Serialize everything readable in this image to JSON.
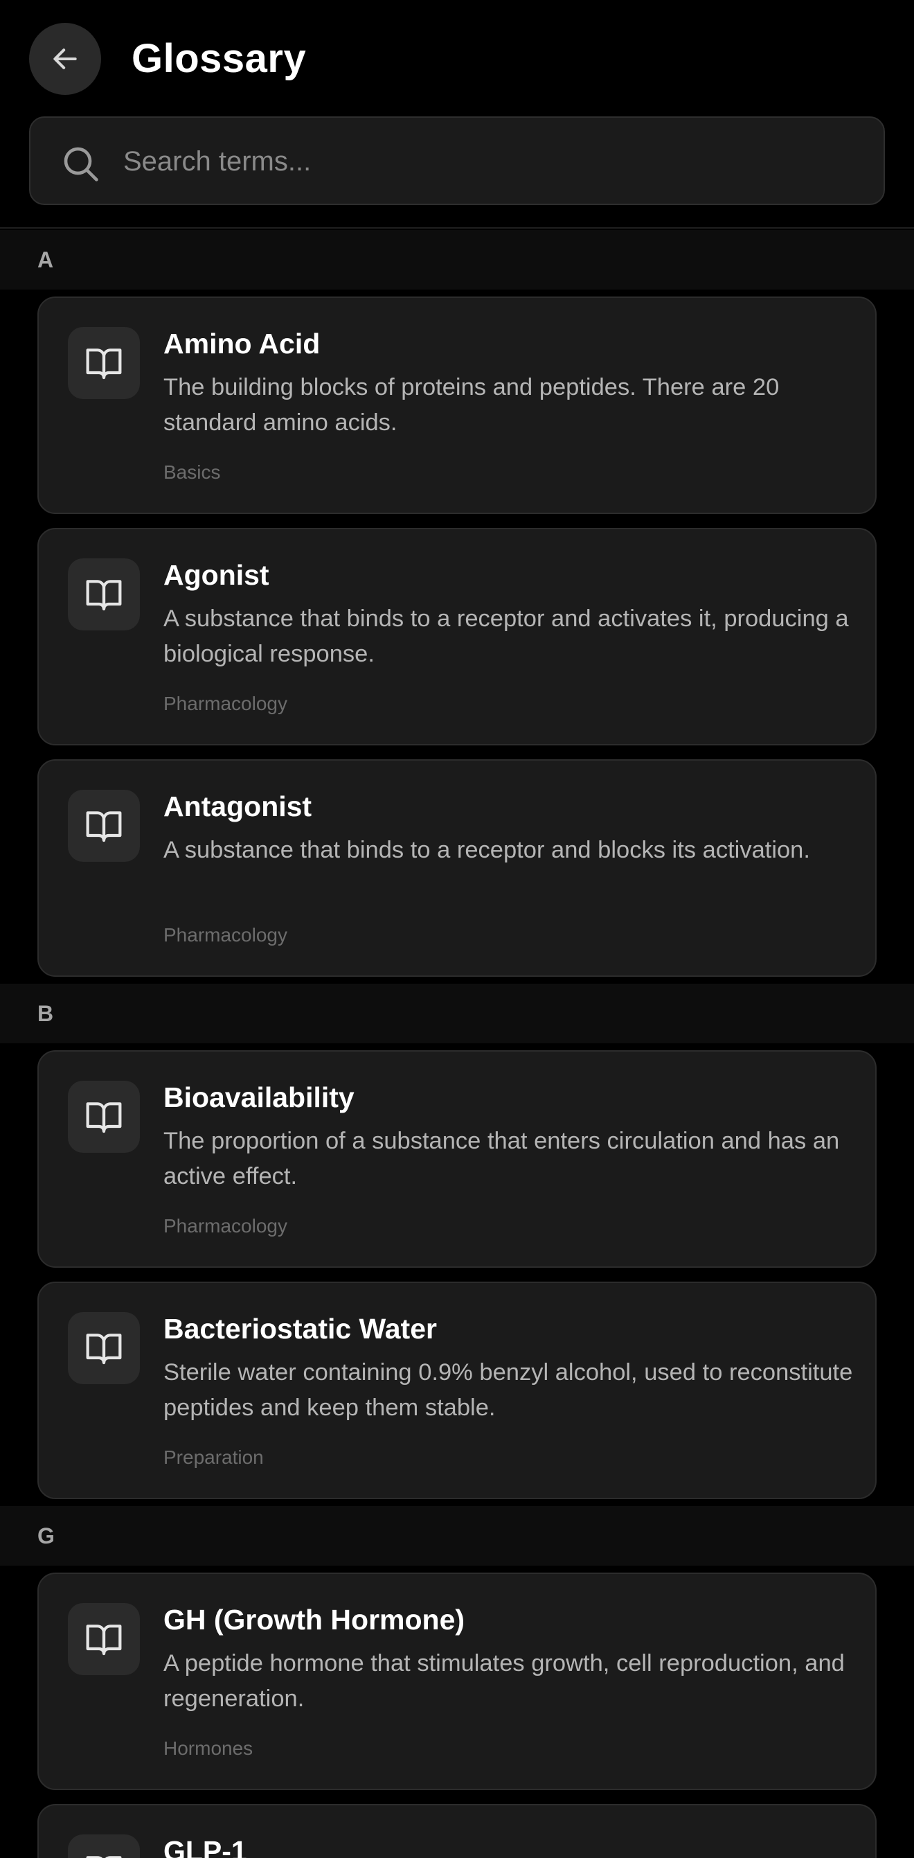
{
  "header": {
    "title": "Glossary",
    "back_icon": "arrow-left-icon"
  },
  "search": {
    "placeholder": "Search terms...",
    "value": "",
    "icon": "search-icon"
  },
  "colors": {
    "background": "#000000",
    "card": "#1b1b1b",
    "section_header": "#0d0d0d",
    "text_primary": "#ffffff",
    "text_secondary": "#b5b5b5",
    "text_muted": "#6c6c6c"
  },
  "sections": [
    {
      "letter": "A",
      "terms": [
        {
          "title": "Amino Acid",
          "description": "The building blocks of proteins and peptides. There are 20 standard amino acids.",
          "category": "Basics",
          "icon": "book-open-icon"
        },
        {
          "title": "Agonist",
          "description": "A substance that binds to a receptor and activates it, producing a biological response.",
          "category": "Pharmacology",
          "icon": "book-open-icon"
        },
        {
          "title": "Antagonist",
          "description": "A substance that binds to a receptor and blocks its activation.",
          "category": "Pharmacology",
          "icon": "book-open-icon"
        }
      ]
    },
    {
      "letter": "B",
      "terms": [
        {
          "title": "Bioavailability",
          "description": "The proportion of a substance that enters circulation and has an active effect.",
          "category": "Pharmacology",
          "icon": "book-open-icon"
        },
        {
          "title": "Bacteriostatic Water",
          "description": "Sterile water containing 0.9% benzyl alcohol, used to reconstitute peptides and keep them stable.",
          "category": "Preparation",
          "icon": "book-open-icon"
        }
      ]
    },
    {
      "letter": "G",
      "terms": [
        {
          "title": "GH (Growth Hormone)",
          "description": "A peptide hormone that stimulates growth, cell reproduction, and regeneration.",
          "category": "Hormones",
          "icon": "book-open-icon"
        },
        {
          "title": "GLP-1",
          "description": "",
          "category": "",
          "icon": "book-open-icon"
        }
      ]
    }
  ]
}
